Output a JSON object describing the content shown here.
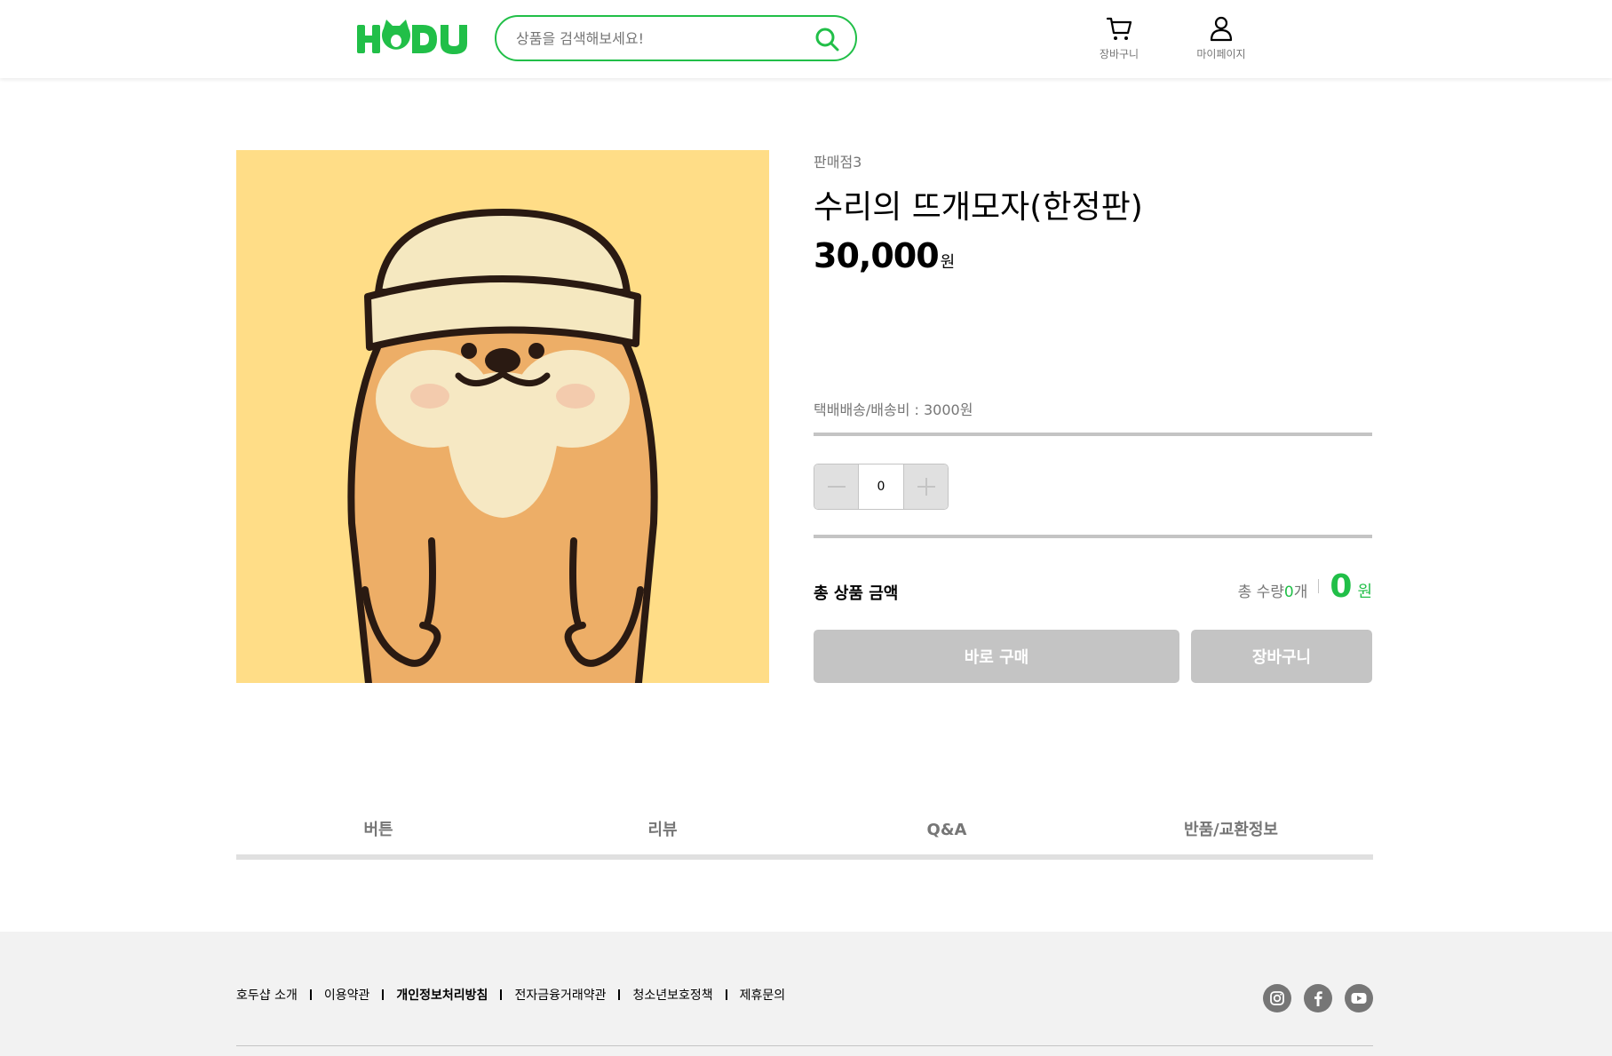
{
  "header": {
    "logo_text": "HODU",
    "search_placeholder": "상품을 검색해보세요!",
    "cart_label": "장바구니",
    "mypage_label": "마이페이지"
  },
  "product": {
    "seller": "판매점3",
    "name": "수리의 뜨개모자(한정판)",
    "price": "30,000",
    "price_unit": "원",
    "shipping": "택배배송/배송비 : 3000원",
    "quantity": "0"
  },
  "total": {
    "label": "총 상품 금액",
    "count_label": "총 수량",
    "count": "0",
    "count_unit": "개",
    "amount": "0",
    "amount_unit": "원"
  },
  "buttons": {
    "buy": "바로 구매",
    "cart": "장바구니"
  },
  "tabs": [
    "버튼",
    "리뷰",
    "Q&A",
    "반품/교환정보"
  ],
  "footer": {
    "links": [
      "호두샵 소개",
      "이용약관",
      "개인정보처리방침",
      "전자금융거래약관",
      "청소년보호정책",
      "제휴문의"
    ]
  },
  "colors": {
    "accent": "#21bf48",
    "disabled": "#c4c4c4",
    "product_bg": "#ffdd87"
  },
  "icons": [
    "search-icon",
    "cart-icon",
    "user-icon",
    "instagram-icon",
    "facebook-icon",
    "youtube-icon"
  ]
}
